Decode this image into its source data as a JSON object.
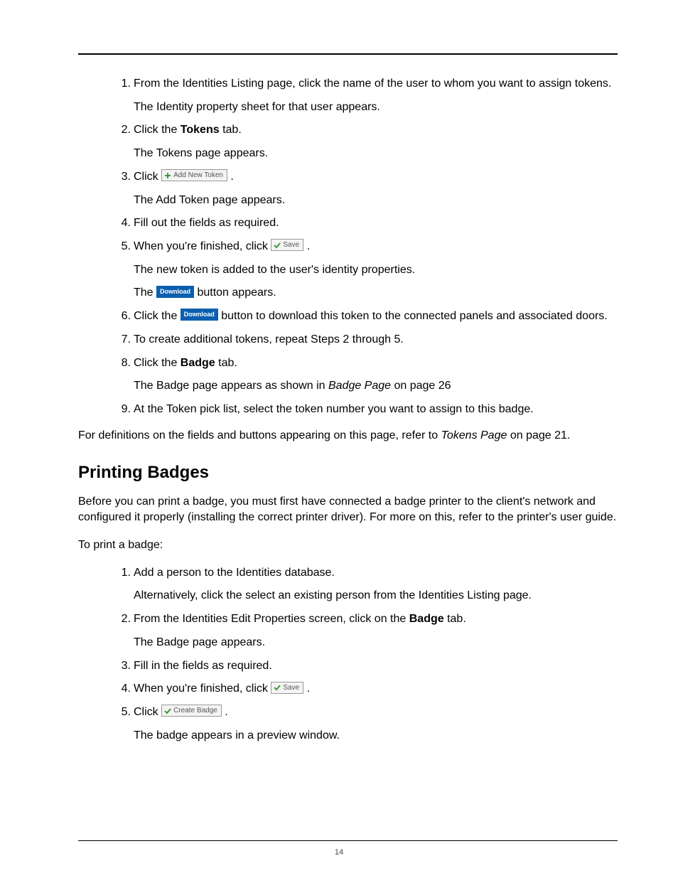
{
  "page_number": "14",
  "buttons": {
    "add_new_token": "Add New Token",
    "save": "Save",
    "download": "Download",
    "create_badge": "Create Badge"
  },
  "list1": {
    "i1": {
      "main": "From the Identities Listing page, click the name of the user to whom you want to assign tokens.",
      "sub": "The Identity property sheet for that user appears."
    },
    "i2": {
      "pre": "Click the ",
      "bold": "Tokens",
      "post": " tab.",
      "sub": "The Tokens page appears."
    },
    "i3": {
      "pre": "Click ",
      "post": " .",
      "sub": "The Add Token page appears."
    },
    "i4": {
      "main": "Fill out the fields as required."
    },
    "i5": {
      "pre": "When you're finished, click ",
      "post": " .",
      "sub1": "The new token is added to the user's identity properties.",
      "sub2_pre": "The ",
      "sub2_post": " button appears."
    },
    "i6": {
      "pre": "Click the ",
      "post": " button to download this token to the connected panels and associated doors."
    },
    "i7": {
      "main": "To create additional tokens, repeat Steps 2 through 5."
    },
    "i8": {
      "pre": "Click the ",
      "bold": "Badge",
      "post": " tab.",
      "sub_pre": "The Badge page appears as shown in ",
      "sub_link": "Badge Page",
      "sub_post": " on page 26"
    },
    "i9": {
      "main": "At the Token pick list, select the token number you want to assign to this badge."
    }
  },
  "para1": {
    "pre": "For definitions on the fields and buttons appearing on this page, refer to ",
    "link": "Tokens Page",
    "post": " on page 21."
  },
  "heading": "Printing Badges",
  "para2": "Before you can print a badge, you must first have connected a badge printer to the client's network and configured it properly (installing the correct printer driver). For more on this, refer to the printer's user guide.",
  "para3": "To print a badge:",
  "list2": {
    "i1": {
      "main": "Add a person to the Identities database.",
      "sub": "Alternatively, click the select an existing person from the Identities Listing page."
    },
    "i2": {
      "pre": "From the Identities Edit Properties screen, click on the ",
      "bold": "Badge",
      "post": " tab.",
      "sub": "The Badge page appears."
    },
    "i3": {
      "main": "Fill in the fields as required."
    },
    "i4": {
      "pre": "When you're finished, click ",
      "post": " ."
    },
    "i5": {
      "pre": "Click ",
      "post": " .",
      "sub": "The badge appears in a preview window."
    }
  }
}
